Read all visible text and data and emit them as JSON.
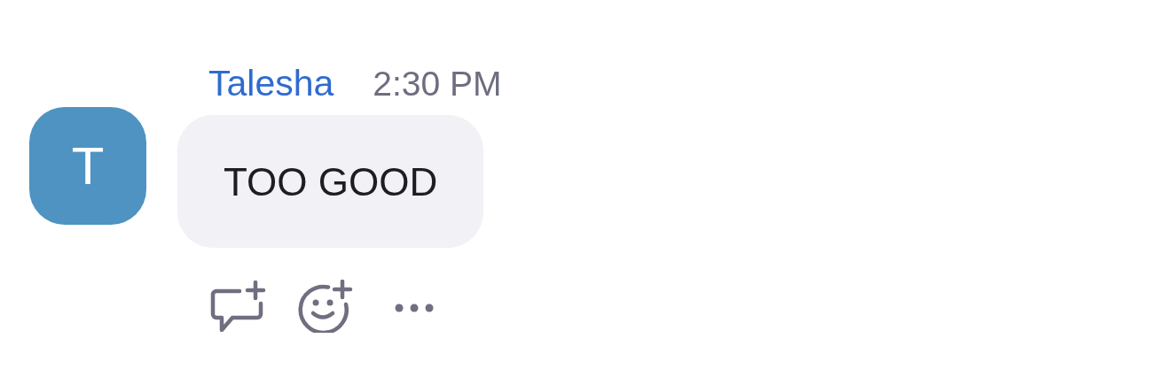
{
  "message": {
    "avatar": {
      "initial": "T",
      "color": "#4e93c2"
    },
    "sender": "Talesha",
    "time": "2:30 PM",
    "text": "TOO GOOD",
    "actions": [
      {
        "kind": "reply"
      },
      {
        "kind": "react"
      },
      {
        "kind": "more"
      }
    ]
  }
}
